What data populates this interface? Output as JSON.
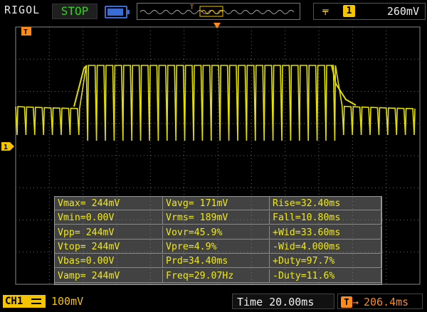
{
  "header": {
    "brand": "RIGOL",
    "run_status": "STOP",
    "trigger_edge_icon": "rising-edge-icon",
    "trigger_source": "1",
    "trigger_level": "260mV",
    "horizontal_trigger_marker": "T"
  },
  "markers": {
    "trigger_position": "T",
    "channel_ground": "1"
  },
  "measurements": [
    [
      "Vmax= 244mV",
      "Vavg= 171mV",
      "Rise=32.40ms"
    ],
    [
      "Vmin=0.00V",
      "Vrms= 189mV",
      "Fall=10.80ms"
    ],
    [
      "Vpp= 244mV",
      "Vovr=45.9%",
      "+Wid=33.60ms"
    ],
    [
      "Vtop= 244mV",
      "Vpre=4.9%",
      "-Wid=4.000ms"
    ],
    [
      "Vbas=0.00V",
      "Prd=34.40ms",
      "+Duty=97.7%"
    ],
    [
      "Vamp= 244mV",
      "Freq=29.07Hz",
      "-Duty=11.6%"
    ]
  ],
  "footer": {
    "channel_label": "CH1",
    "channel_scale": "100mV",
    "timebase": "Time 20.00ms",
    "trigger_offset": "206.4ms",
    "trigger_offset_icon": "T"
  },
  "colors": {
    "trace": "#e3e000",
    "grid": "#6a6a6a",
    "status": "#34d11e",
    "trigger": "#ff8a1a",
    "channel": "#f5c400"
  }
}
